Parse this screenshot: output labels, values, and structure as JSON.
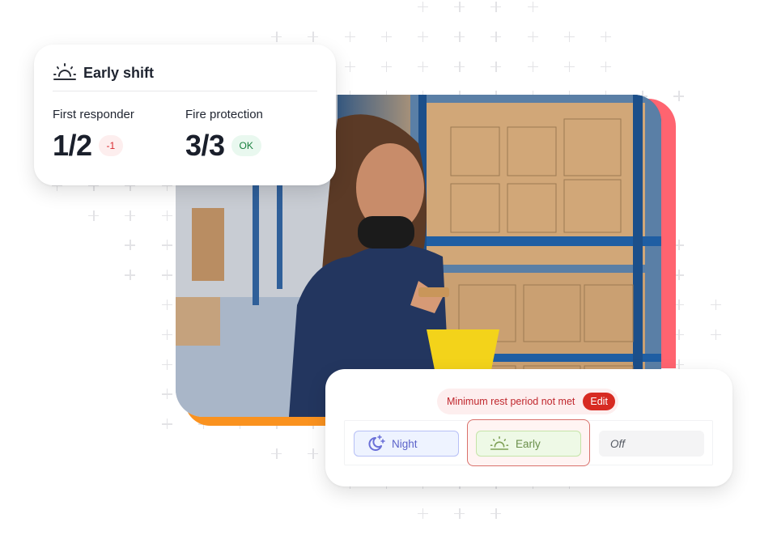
{
  "shift_card": {
    "icon": "sunrise-icon",
    "title": "Early shift",
    "metrics": [
      {
        "label": "First responder",
        "value": "1/2",
        "badge": "-1",
        "badge_status": "deficit"
      },
      {
        "label": "Fire protection",
        "value": "3/3",
        "badge": "OK",
        "badge_status": "ok"
      }
    ]
  },
  "photo": {
    "description": "Warehouse worker with headphones looking at phone, holding yellow bucket, shelves of cardboard boxes behind"
  },
  "rest_card": {
    "warning_text": "Minimum rest period not met",
    "edit_label": "Edit",
    "options": [
      {
        "label": "Night",
        "icon": "moon-stars-icon",
        "selected": false
      },
      {
        "label": "Early",
        "icon": "sunrise-icon",
        "selected": true
      },
      {
        "label": "Off",
        "icon": "",
        "selected": false
      }
    ]
  },
  "colors": {
    "accent_red": "#ff6470",
    "accent_orange": "#fa921f",
    "warning_red": "#d72b22",
    "ok_green": "#17803d",
    "night_purple": "#5c63c9",
    "early_green": "#6a8f4a"
  }
}
